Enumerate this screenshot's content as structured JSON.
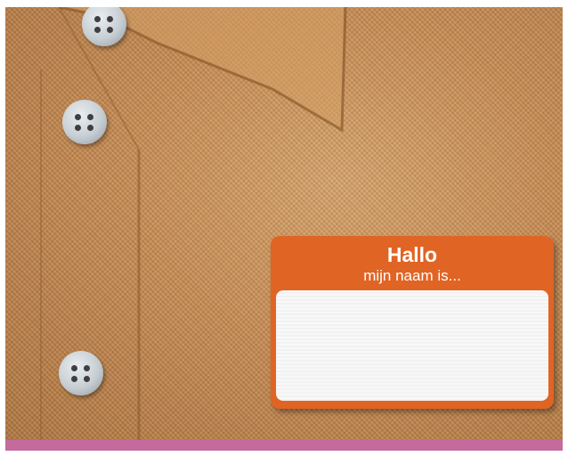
{
  "name_tag": {
    "title": "Hallo",
    "subtitle": "mijn naam is..."
  },
  "colors": {
    "fabric": "#c88c52",
    "tag_orange": "#e06424",
    "tag_blank": "#f5f5f5",
    "band": "#c56a9c",
    "button": "#c7ced3"
  }
}
